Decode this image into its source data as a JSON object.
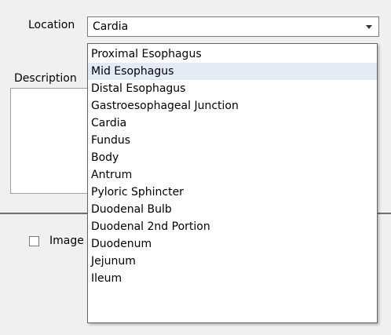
{
  "form": {
    "location_label": "Location",
    "location_value": "Cardia",
    "description_label": "Description",
    "image_label": "Image"
  },
  "dropdown": {
    "highlighted_index": 1,
    "options": [
      "Proximal Esophagus",
      "Mid Esophagus",
      "Distal Esophagus",
      "Gastroesophageal Junction",
      "Cardia",
      "Fundus",
      "Body",
      "Antrum",
      "Pyloric Sphincter",
      "Duodenal Bulb",
      "Duodenal 2nd Portion",
      "Duodenum",
      "Jejunum",
      "Ileum"
    ]
  },
  "colors": {
    "background": "#f0f0f0",
    "highlight": "#e5eaf7",
    "border": "#7a7a7a"
  }
}
